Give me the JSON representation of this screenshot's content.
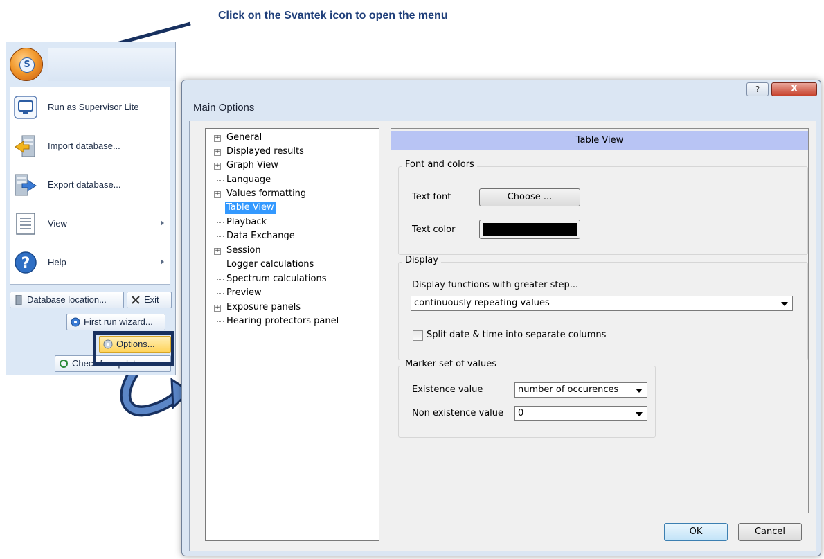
{
  "instruction": "Click on the Svantek icon to open the menu",
  "app_menu": {
    "orb_glyph": "S",
    "items": [
      {
        "label": "Run as Supervisor Lite",
        "icon": "monitor-icon"
      },
      {
        "label": "Import database...",
        "icon": "import-database-icon"
      },
      {
        "label": "Export database...",
        "icon": "export-database-icon"
      },
      {
        "label": "View",
        "icon": "document-icon"
      },
      {
        "label": "Help",
        "icon": "help-icon"
      }
    ],
    "database_location": "Database location...",
    "exit": "Exit",
    "first_run_wizard": "First run wizard...",
    "options": "Options...",
    "check_for_updates": "Check for updates..."
  },
  "dialog": {
    "title": "Main Options",
    "help_glyph": "?",
    "close_glyph": "X",
    "tree": [
      {
        "label": "General",
        "expandable": true
      },
      {
        "label": "Displayed results",
        "expandable": true
      },
      {
        "label": "Graph View",
        "expandable": true
      },
      {
        "label": "Language",
        "expandable": false
      },
      {
        "label": "Values formatting",
        "expandable": true
      },
      {
        "label": "Table View",
        "expandable": false,
        "selected": true
      },
      {
        "label": "Playback",
        "expandable": false
      },
      {
        "label": "Data Exchange",
        "expandable": false
      },
      {
        "label": "Session",
        "expandable": true
      },
      {
        "label": "Logger calculations",
        "expandable": false
      },
      {
        "label": "Spectrum calculations",
        "expandable": false
      },
      {
        "label": "Preview",
        "expandable": false
      },
      {
        "label": "Exposure panels",
        "expandable": true
      },
      {
        "label": "Hearing protectors panel",
        "expandable": false
      }
    ],
    "panel_title": "Table View",
    "font_colors": {
      "group": "Font and colors",
      "text_font_label": "Text font",
      "choose_button": "Choose ...",
      "text_color_label": "Text color",
      "text_color_value": "#000000"
    },
    "display": {
      "group": "Display",
      "functions_label": "Display functions with greater step...",
      "functions_value": "continuously repeating values",
      "split_label": "Split date & time into separate columns",
      "split_checked": false
    },
    "marker": {
      "group": "Marker set of values",
      "existence_label": "Existence value",
      "existence_value": "number of occurences",
      "non_existence_label": "Non existence value",
      "non_existence_value": "0"
    },
    "ok": "OK",
    "cancel": "Cancel"
  },
  "colors": {
    "instruction": "#1f3f7a",
    "highlight_frame": "#17305f",
    "tree_selection": "#3399ff",
    "panel_header": "#b8c4f4"
  }
}
